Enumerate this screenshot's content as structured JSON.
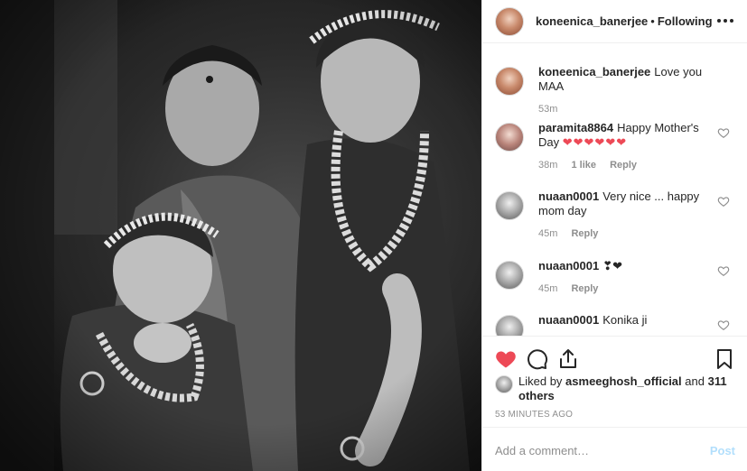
{
  "header": {
    "username": "koneenica_banerjee",
    "separator": "•",
    "follow_status": "Following",
    "more_icon": "more-options-icon"
  },
  "comments": [
    {
      "username": "koneenica_banerjee",
      "text": "Love you MAA",
      "time": "53m",
      "likes": "",
      "reply": ""
    },
    {
      "username": "paramita8864",
      "text": "Happy Mother's Day",
      "emoji": "❤❤❤❤❤❤",
      "time": "38m",
      "likes": "1 like",
      "reply": "Reply"
    },
    {
      "username": "nuaan0001",
      "text": "Very nice ... happy mom day",
      "time": "45m",
      "reply": "Reply"
    },
    {
      "username": "nuaan0001",
      "text": "❣❤",
      "time": "45m",
      "reply": "Reply"
    },
    {
      "username": "nuaan0001",
      "text": "Konika ji",
      "time": "",
      "reply": ""
    }
  ],
  "actions": {
    "like_icon": "heart-filled-icon",
    "comment_icon": "comment-bubble-icon",
    "share_icon": "share-icon",
    "save_icon": "bookmark-icon"
  },
  "likes": {
    "prefix": "Liked by",
    "user": "asmeeghosh_official",
    "and": "and",
    "others": "311 others"
  },
  "timestamp": "53 MINUTES AGO",
  "add_comment": {
    "placeholder": "Add a comment…",
    "post_label": "Post"
  },
  "colors": {
    "like_red": "#ed4956",
    "post_disabled_blue": "#b2dffc",
    "meta_gray": "#8e8e8e"
  }
}
